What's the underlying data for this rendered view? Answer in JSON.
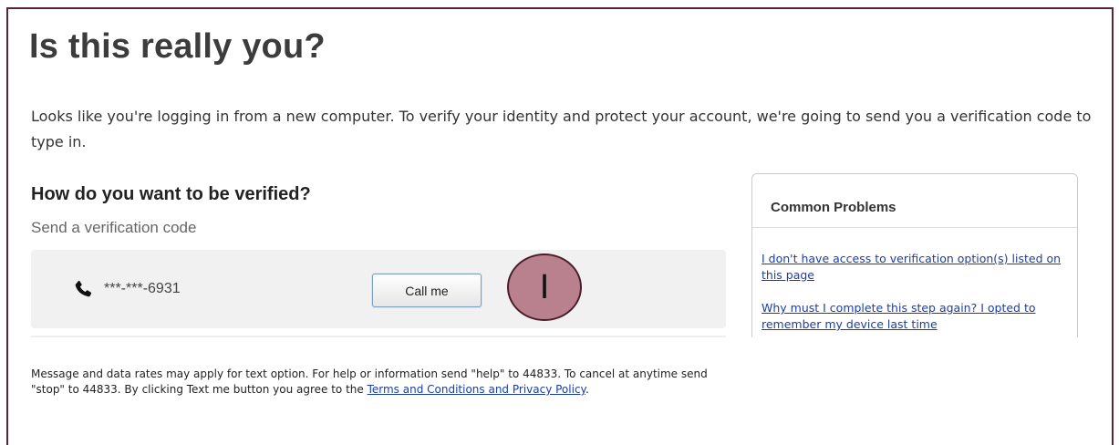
{
  "page": {
    "title": "Is this really you?",
    "intro": "Looks like you're logging in from a new computer. To verify your identity and protect your account, we're going to send you a verification code to type in."
  },
  "verification": {
    "heading": "How do you want to be verified?",
    "subheading": "Send a verification code",
    "phone_icon": "phone-icon",
    "phone_number": "***-***-6931",
    "call_button_label": "Call me",
    "step_marker_label": "I"
  },
  "sidebar": {
    "title": "Common Problems",
    "links": [
      "I don't have access to verification option(s) listed on this page",
      "Why must I complete this step again? I opted to remember my device last time"
    ]
  },
  "disclaimer": {
    "text": "Message and data rates may apply for text option. For help or information send \"help\" to 44833. To cancel at anytime send \"stop\" to 44833. By clicking Text me button you agree to the ",
    "link_text": "Terms and Conditions and Privacy Policy",
    "suffix": "."
  },
  "colors": {
    "frame_border": "#5a2435",
    "link": "#1a3ea8",
    "marker_fill": "#b9808d",
    "panel_bg": "#f1f1f1"
  }
}
